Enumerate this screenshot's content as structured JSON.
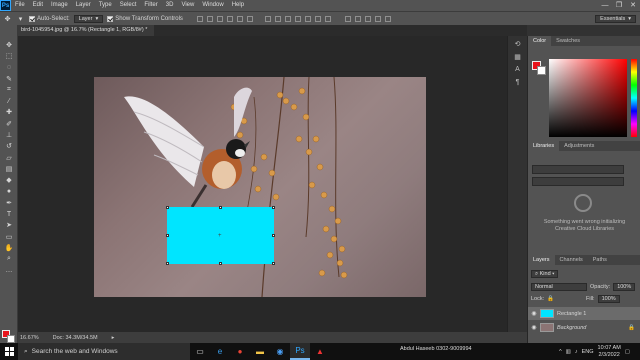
{
  "app": {
    "logo": "Ps",
    "menu": [
      "File",
      "Edit",
      "Image",
      "Layer",
      "Type",
      "Select",
      "Filter",
      "3D",
      "View",
      "Window",
      "Help"
    ],
    "window_controls": [
      "—",
      "❐",
      "✕"
    ]
  },
  "options_bar": {
    "auto_select_label": "Auto-Select:",
    "auto_select_value": "Layer",
    "show_transform_label": "Show Transform Controls",
    "workspace": "Essentials"
  },
  "document": {
    "tab_title": "bird-1045954.jpg @ 16.7% (Rectangle 1, RGB/8#) *",
    "zoom": "16.67%",
    "doc_size": "Doc: 34.3M/34.5M"
  },
  "colors": {
    "foreground": "#e8141c",
    "background": "#ffffff",
    "shape_fill": "#00e5ff"
  },
  "panels": {
    "color_tabs": [
      "Color",
      "Swatches"
    ],
    "library_tabs": [
      "Libraries",
      "Adjustments"
    ],
    "library_message": "Something went wrong initializing Creative Cloud Libraries",
    "layers_tabs": [
      "Layers",
      "Channels",
      "Paths"
    ],
    "kind_label": "Kind",
    "blend_mode": "Normal",
    "opacity_label": "Opacity:",
    "opacity_value": "100%",
    "lock_label": "Lock:",
    "fill_label": "Fill:",
    "fill_value": "100%",
    "layers": [
      {
        "name": "Rectangle 1",
        "selected": true
      },
      {
        "name": "Background",
        "selected": false
      }
    ]
  },
  "taskbar": {
    "search_placeholder": "Search the web and Windows",
    "user_text": "Abdul Haseeb  0302-9009994",
    "language": "ENG",
    "time": "10:07 AM",
    "date": "2/3/2022"
  }
}
